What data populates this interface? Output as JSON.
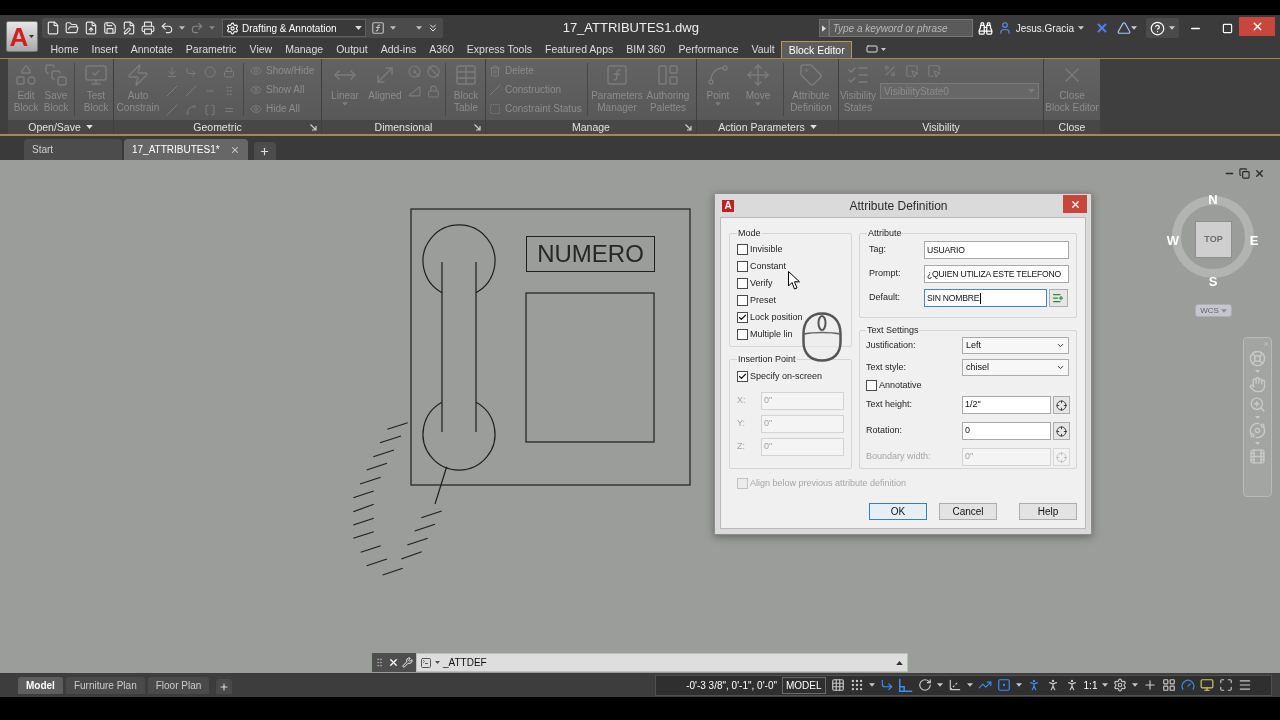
{
  "title_bar": {
    "app_logo": "A",
    "workspace": "Drafting & Annotation",
    "title": "17_ATTRIBUTES1.dwg",
    "search": {
      "placeholder": "Type a keyword or phrase"
    },
    "user": "Jesus.Gracia"
  },
  "ribbon_tabs": [
    {
      "label": "Home",
      "selected": false
    },
    {
      "label": "Insert",
      "selected": false
    },
    {
      "label": "Annotate",
      "selected": false
    },
    {
      "label": "Parametric",
      "selected": false
    },
    {
      "label": "View",
      "selected": false
    },
    {
      "label": "Manage",
      "selected": false
    },
    {
      "label": "Output",
      "selected": false
    },
    {
      "label": "Add-ins",
      "selected": false
    },
    {
      "label": "A360",
      "selected": false
    },
    {
      "label": "Express Tools",
      "selected": false
    },
    {
      "label": "Featured Apps",
      "selected": false
    },
    {
      "label": "BIM 360",
      "selected": false
    },
    {
      "label": "Performance",
      "selected": false
    },
    {
      "label": "Vault",
      "selected": false
    },
    {
      "label": "Block Editor",
      "selected": true
    }
  ],
  "ribbon": {
    "disabled": true,
    "panels": [
      {
        "title": "Open/Save",
        "menu": true,
        "tools": [
          {
            "lines": [
              "Edit",
              "Block"
            ]
          },
          {
            "lines": [
              "Save",
              "Block"
            ]
          },
          {
            "lines": [
              "Test",
              "Block"
            ]
          }
        ]
      },
      {
        "title": "Geometric",
        "launcher": true,
        "tools": [
          {
            "lines": [
              "Auto",
              "Constrain"
            ]
          }
        ],
        "commands": [
          "Show/Hide",
          "Show All",
          "Hide All"
        ]
      },
      {
        "title": "Dimensional",
        "launcher": true,
        "tools": [
          {
            "lines": [
              "Linear"
            ],
            "dropdown": true
          },
          {
            "lines": [
              "Aligned"
            ]
          },
          {
            "lines": [
              "Block",
              "Table"
            ]
          }
        ]
      },
      {
        "title": "Manage",
        "launcher": true,
        "commands": [
          "Delete",
          "Construction",
          "Constraint Status"
        ],
        "tools": [
          {
            "lines": [
              "Parameters",
              "Manager"
            ]
          },
          {
            "lines": [
              "Authoring",
              "Palettes"
            ]
          }
        ]
      },
      {
        "title": "Action Parameters",
        "menu": true,
        "tools": [
          {
            "lines": [
              "Point"
            ],
            "dropdown": true
          },
          {
            "lines": [
              "Move"
            ],
            "dropdown": true
          },
          {
            "lines": [
              "Attribute",
              "Definition"
            ]
          }
        ]
      },
      {
        "title": "Visibility",
        "tools": [
          {
            "lines": [
              "Visibility",
              "States"
            ]
          }
        ],
        "state_select": "VisibilityState0"
      },
      {
        "title": "Close",
        "tools": [
          {
            "lines": [
              "Close",
              "Block Editor"
            ]
          }
        ]
      }
    ]
  },
  "document_tabs": [
    {
      "label": "Start",
      "selected": false
    },
    {
      "label": "17_ATTRIBUTES1*",
      "selected": true
    }
  ],
  "drawing": {
    "label": "NUMERO"
  },
  "viewcube": {
    "face": "TOP",
    "north": "N",
    "south": "S",
    "east": "E",
    "west": "W",
    "ucs": "WCS"
  },
  "dialog": {
    "logo": "A",
    "title": "Attribute Definition",
    "mode": {
      "heading": "Mode",
      "options": [
        {
          "label": "Invisible",
          "checked": false
        },
        {
          "label": "Constant",
          "checked": false
        },
        {
          "label": "Verify",
          "checked": false
        },
        {
          "label": "Preset",
          "checked": false
        },
        {
          "label": "Lock position",
          "checked": true
        },
        {
          "label": "Multiple lin",
          "checked": false
        }
      ]
    },
    "insertion_point": {
      "heading": "Insertion Point",
      "specify_on_screen": {
        "label": "Specify on-screen",
        "checked": true
      },
      "coordinates": [
        {
          "label": "X:",
          "value": "0\"",
          "disabled": true
        },
        {
          "label": "Y:",
          "value": "0\"",
          "disabled": true
        },
        {
          "label": "Z:",
          "value": "0\"",
          "disabled": true
        }
      ]
    },
    "attribute": {
      "heading": "Attribute",
      "fields": [
        {
          "label": "Tag:",
          "value": "USUARIO",
          "focused": false
        },
        {
          "label": "Prompt:",
          "value": "¿QUIEN UTILIZA ESTE TELEFONO",
          "focused": false
        },
        {
          "label": "Default:",
          "value": "SIN NOMBRE",
          "focused": true,
          "insert_field": true
        }
      ]
    },
    "text_settings": {
      "heading": "Text Settings",
      "rows": [
        {
          "kind": "select",
          "label": "Justification:",
          "value": "Left",
          "disabled": false
        },
        {
          "kind": "select",
          "label": "Text style:",
          "value": "chisel",
          "disabled": false
        },
        {
          "kind": "checkbox",
          "label": "Annotative",
          "checked": false,
          "disabled": false
        },
        {
          "kind": "pick",
          "label": "Text height:",
          "value": "1/2\"",
          "disabled": false
        },
        {
          "kind": "pick",
          "label": "Rotation:",
          "value": "0",
          "disabled": false
        },
        {
          "kind": "pick",
          "label": "Boundary width:",
          "value": "0\"",
          "disabled": true
        }
      ]
    },
    "align_below": {
      "label": "Align below previous attribute definition",
      "checked": false,
      "disabled": true
    },
    "buttons": [
      {
        "label": "OK",
        "default": true
      },
      {
        "label": "Cancel",
        "default": false
      },
      {
        "label": "Help",
        "default": false
      }
    ]
  },
  "command_line": {
    "text": "_ATTDEF"
  },
  "layout_tabs": [
    {
      "label": "Model",
      "selected": true
    },
    {
      "label": "Furniture Plan",
      "selected": false
    },
    {
      "label": "Floor Plan",
      "selected": false
    }
  ],
  "status_bar": {
    "coordinates": "-0'-3 3/8\", 0'-1\", 0'-0\"",
    "space": "MODEL",
    "toggles": [
      {
        "on": false
      },
      {
        "on": false
      },
      {
        "on": true
      },
      {
        "on": true
      },
      {
        "on": false
      },
      {
        "on": false
      },
      {
        "on": true
      },
      {
        "on": true
      },
      {
        "on": true
      },
      {
        "on": false
      },
      {
        "on": false
      },
      {
        "on": true
      }
    ],
    "scale": "1:1"
  }
}
